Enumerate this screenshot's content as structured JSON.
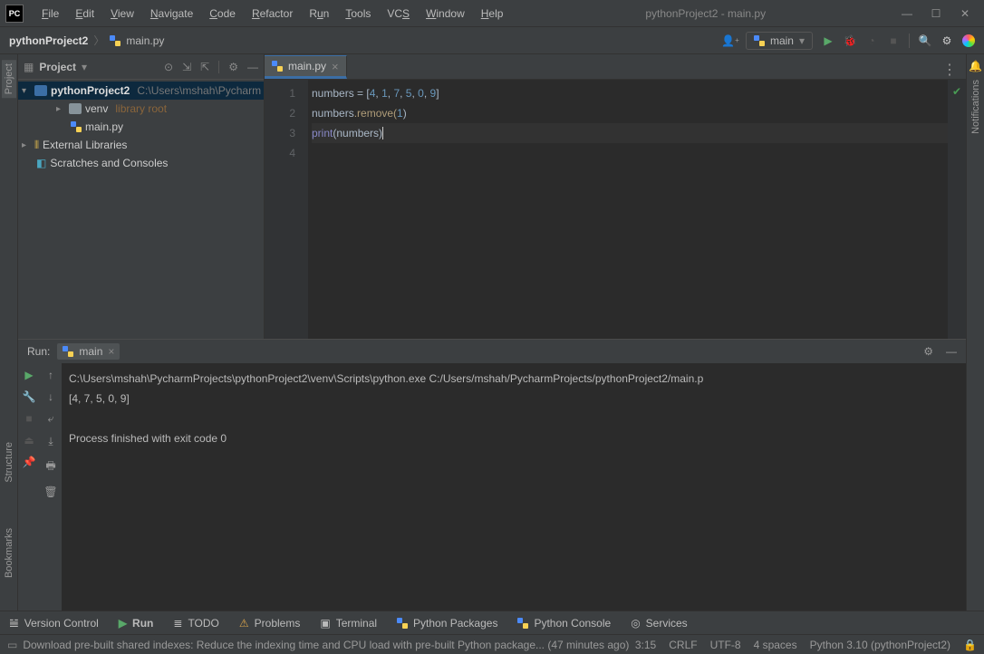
{
  "title": "pythonProject2 - main.py",
  "menu": [
    "File",
    "Edit",
    "View",
    "Navigate",
    "Code",
    "Refactor",
    "Run",
    "Tools",
    "VCS",
    "Window",
    "Help"
  ],
  "breadcrumb": {
    "project": "pythonProject2",
    "file": "main.py"
  },
  "runconfig": {
    "name": "main"
  },
  "project_panel": {
    "title": "Project",
    "root": "pythonProject2",
    "root_path": "C:\\Users\\mshah\\Pycharm",
    "venv_label": "venv",
    "venv_note": "library root",
    "file": "main.py",
    "ext": "External Libraries",
    "scratches": "Scratches and Consoles"
  },
  "editor": {
    "tab": "main.py",
    "lines": [
      "1",
      "2",
      "3",
      "4"
    ],
    "code": {
      "l1_var": "numbers ",
      "l1_eq": "= [",
      "l1_nums": [
        "4",
        "1",
        "7",
        "5",
        "0",
        "9"
      ],
      "l1_close": "]",
      "l2_a": "numbers",
      "l2_b": ".remove(",
      "l2_n": "1",
      "l2_c": ")",
      "l3_fn": "print",
      "l3_open": "(",
      "l3_arg": "numbers",
      "l3_close": ")"
    }
  },
  "run": {
    "label": "Run:",
    "tab": "main",
    "output_cmd": "C:\\Users\\mshah\\PycharmProjects\\pythonProject2\\venv\\Scripts\\python.exe C:/Users/mshah/PycharmProjects/pythonProject2/main.p",
    "output_result": "[4, 7, 5, 0, 9]",
    "output_exit": "Process finished with exit code 0"
  },
  "bottom": {
    "vcs": "Version Control",
    "run": "Run",
    "todo": "TODO",
    "problems": "Problems",
    "terminal": "Terminal",
    "packages": "Python Packages",
    "console": "Python Console",
    "services": "Services"
  },
  "status": {
    "msg": "Download pre-built shared indexes: Reduce the indexing time and CPU load with pre-built Python package... (47 minutes ago)",
    "pos": "3:15",
    "crlf": "CRLF",
    "enc": "UTF-8",
    "indent": "4 spaces",
    "sdk": "Python 3.10 (pythonProject2)"
  },
  "sidebars": {
    "project": "Project",
    "structure": "Structure",
    "bookmarks": "Bookmarks",
    "notifications": "Notifications"
  }
}
